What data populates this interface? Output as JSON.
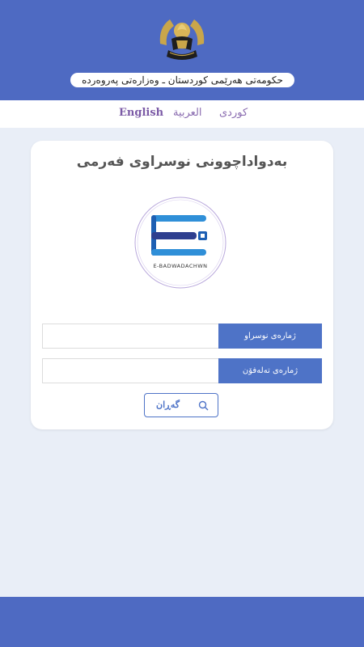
{
  "header": {
    "emblem_icon": "kurdistan-emblem-icon",
    "title": "حکومەتی هەرێمی کوردستان ـ وەزارەتی پەروەردە",
    "bg_color": "#4e6ac2"
  },
  "languages": {
    "english": "English",
    "arabic": "العربية",
    "kurdish": "کوردی"
  },
  "card": {
    "title": "بەدواداچوونی نوسراوی فەرمی",
    "logo_caption": "E-BADWADACHWN",
    "logo_icon": "e-badwadachwn-logo-icon"
  },
  "form": {
    "letter_number_label": "ژمارەی نوسراو",
    "letter_number_value": "",
    "phone_number_label": "ژمارەی تەلەفۆن",
    "phone_number_value": "",
    "search_label": "گەڕان",
    "search_icon": "search-icon",
    "accent_color": "#4e73c7"
  }
}
